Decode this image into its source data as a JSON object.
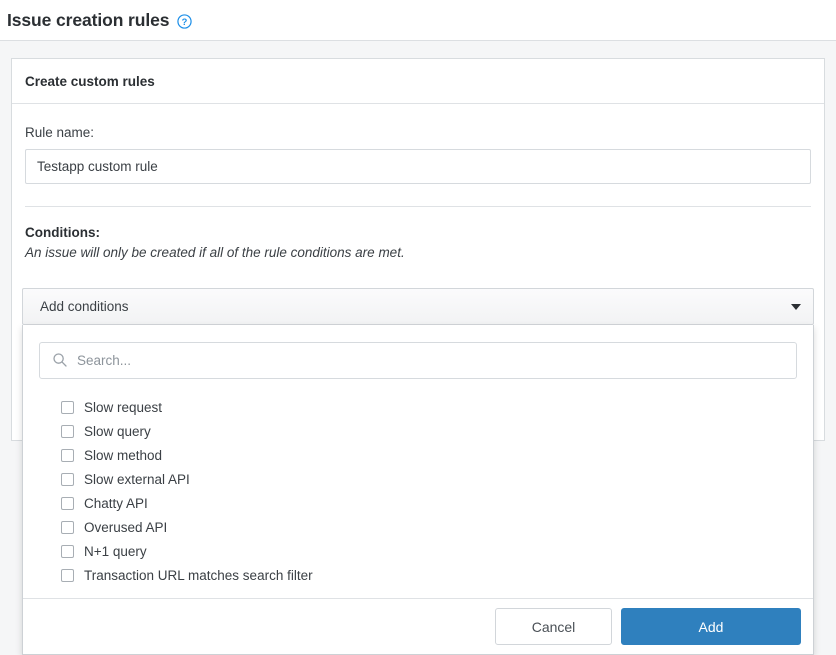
{
  "page": {
    "title": "Issue creation rules",
    "help_icon": "help-circle-icon"
  },
  "card": {
    "header_title": "Create custom rules",
    "rule_name": {
      "label": "Rule name:",
      "value": "Testapp custom rule",
      "placeholder": "Rule name"
    },
    "conditions": {
      "label": "Conditions:",
      "description": "An issue will only be created if all of the rule conditions are met."
    }
  },
  "dropdown": {
    "toggle_label": "Add conditions",
    "caret_icon": "chevron-down-icon",
    "search": {
      "placeholder": "Search...",
      "value": "",
      "icon": "search-icon"
    },
    "options": [
      {
        "label": "Slow request",
        "checked": false
      },
      {
        "label": "Slow query",
        "checked": false
      },
      {
        "label": "Slow method",
        "checked": false
      },
      {
        "label": "Slow external API",
        "checked": false
      },
      {
        "label": "Chatty API",
        "checked": false
      },
      {
        "label": "Overused API",
        "checked": false
      },
      {
        "label": "N+1 query",
        "checked": false
      },
      {
        "label": "Transaction URL matches search filter",
        "checked": false
      }
    ],
    "footer": {
      "cancel_label": "Cancel",
      "add_label": "Add"
    }
  },
  "colors": {
    "accent_blue": "#2f80be",
    "help_icon_blue": "#1d8fe8",
    "page_background": "#f5f6f7",
    "card_background": "#ffffff",
    "border": "#d8dcdf",
    "text": "#3b4045"
  }
}
